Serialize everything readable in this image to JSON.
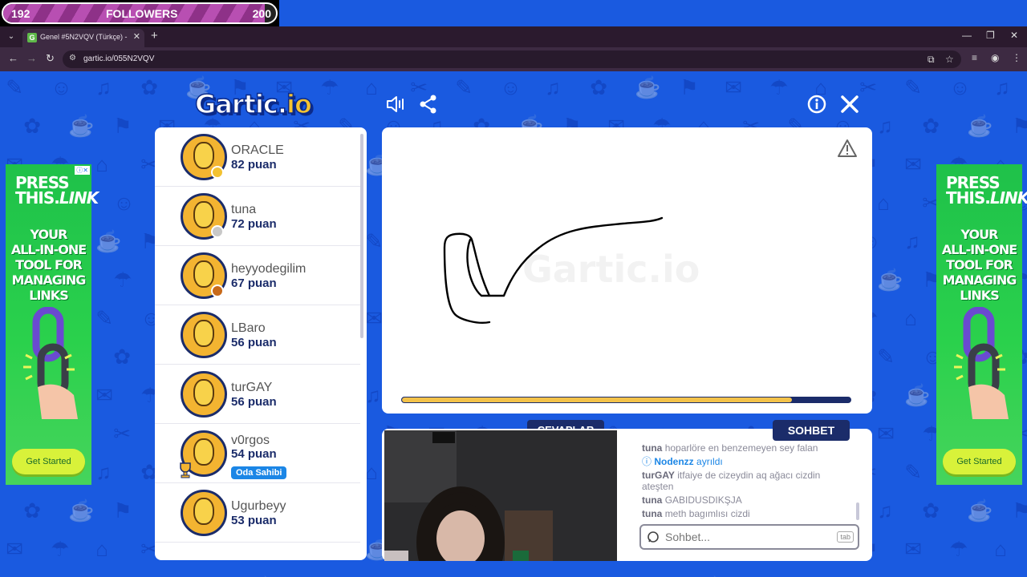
{
  "overlay": {
    "followers_current": "192",
    "followers_label": "FOLLOWERS",
    "followers_goal": "200",
    "progress": 0.96
  },
  "browser": {
    "tab_title": "Genel #5N2VQV (Türkçe) - Gart",
    "favicon_letter": "G",
    "url": "gartic.io/055N2VQV"
  },
  "game": {
    "logo_main": "Gartic.",
    "logo_suffix": "io",
    "watermark": "Gartic.io",
    "timer_progress": 0.87,
    "players": [
      {
        "name": "ORACLE",
        "score": "82 puan",
        "badge": "gold"
      },
      {
        "name": "tuna",
        "score": "72 puan",
        "badge": "silver"
      },
      {
        "name": "heyyodegilim",
        "score": "67 puan",
        "badge": "bronze"
      },
      {
        "name": "LBaro",
        "score": "56 puan",
        "badge": ""
      },
      {
        "name": "turGAY",
        "score": "56 puan",
        "badge": ""
      },
      {
        "name": "v0rgos",
        "score": "54 puan",
        "badge": "",
        "owner_label": "Oda Sahibi"
      },
      {
        "name": "Ugurbeyy",
        "score": "53 puan",
        "badge": ""
      }
    ],
    "tabs": {
      "answers": "CEVAPLAR",
      "chat": "SOHBET"
    },
    "chat": {
      "messages": [
        {
          "user": "tuna",
          "text": "hoparlöre en benzemeyen sey falan"
        },
        {
          "user": "Nodenzz",
          "text": "ayrıldı",
          "system": true
        },
        {
          "user": "turGAY",
          "text": "itfaiye de cizeydin aq ağacı cizdin ateşten"
        },
        {
          "user": "tuna",
          "text": "GABIDUSDIKŞJA"
        },
        {
          "user": "tuna",
          "text": "meth bagımlısı cizdi"
        }
      ],
      "input_placeholder": "Sohbet...",
      "tab_key": "tab"
    }
  },
  "ads": {
    "brand": "PRESS THIS.LINK",
    "brand_line1": "PRESS",
    "brand_line2": "THIS.",
    "brand_line3": "LINK",
    "copy_lines": [
      "YOUR",
      "ALL-IN-ONE",
      "TOOL FOR",
      "MANAGING LINKS"
    ],
    "cta": "Get Started"
  },
  "colors": {
    "page_bg": "#1a5ae0",
    "navy": "#1b2c6a",
    "gold": "#f3c24a",
    "owner_badge": "#1b86e6"
  }
}
